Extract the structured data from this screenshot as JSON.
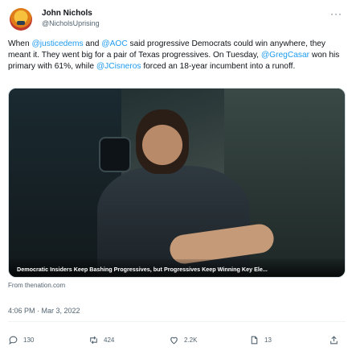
{
  "author": {
    "name": "John Nichols",
    "handle": "@NicholsUprising"
  },
  "more_label": "···",
  "tweet": {
    "seg1": "When ",
    "m1": "@justicedems",
    "seg2": " and ",
    "m2": "@AOC",
    "seg3": " said progressive Democrats could win anywhere, they meant it. They went big for a pair of Texas progressives. On Tuesday, ",
    "m3": "@GregCasar",
    "seg4": " won his primary with 61%, while ",
    "m4": "@JCisneros",
    "seg5": " forced an 18-year incumbent into a runoff."
  },
  "media": {
    "caption": "Democratic Insiders Keep Bashing Progressives, but Progressives Keep Winning Key Ele..."
  },
  "source": "From thenation.com",
  "timestamp": "4:06 PM · Mar 3, 2022",
  "actions": {
    "reply_count": "130",
    "retweet_count": "424",
    "like_count": "2.2K",
    "views_count": "13"
  },
  "colors": {
    "accent": "#1d9bf0",
    "secondary_text": "#536471"
  }
}
